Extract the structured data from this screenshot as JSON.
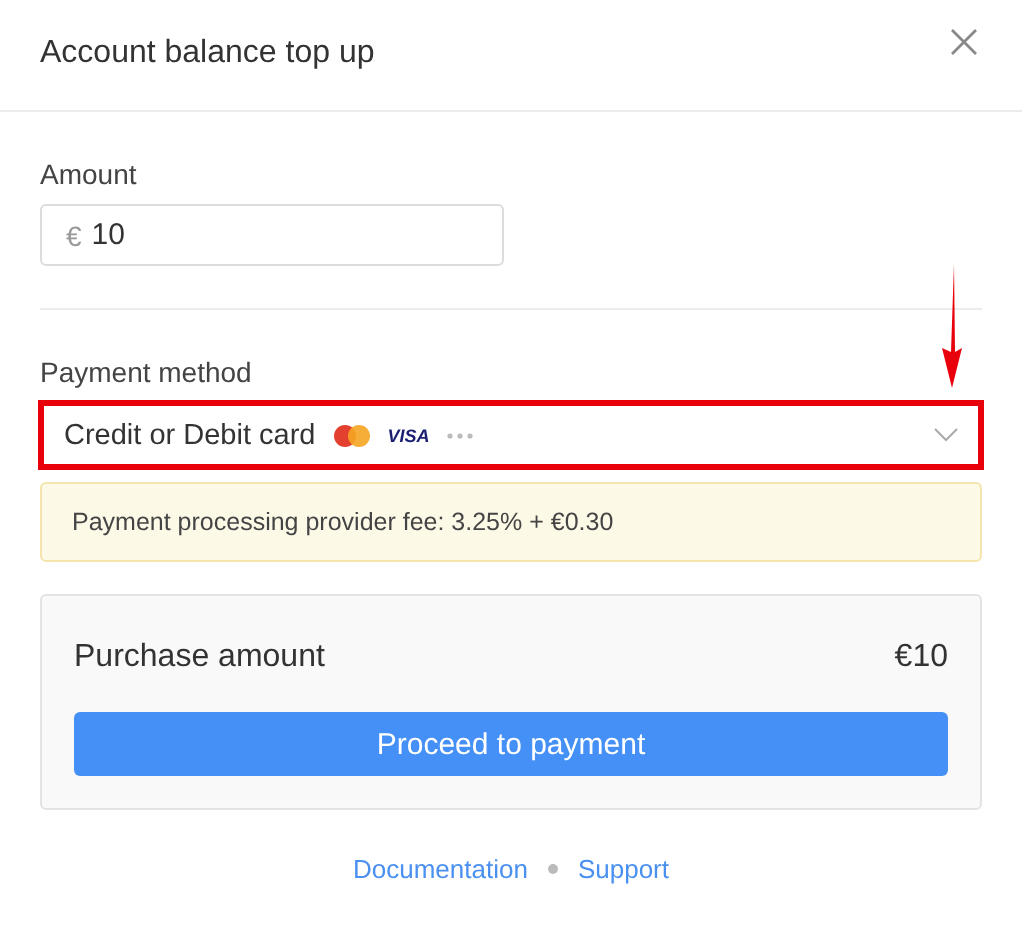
{
  "dialog": {
    "title": "Account balance top up"
  },
  "amount": {
    "label": "Amount",
    "currency": "€",
    "value": "10"
  },
  "payment_method": {
    "label": "Payment method",
    "value": "Credit or Debit card",
    "visa": "VISA",
    "highlighted": true,
    "arrow": true
  },
  "fee_notice": "Payment processing provider fee: 3.25% + €0.30",
  "summary": {
    "label": "Purchase amount",
    "total": "€10",
    "button": "Proceed to payment"
  },
  "footer_links": [
    "Documentation",
    "Support"
  ]
}
